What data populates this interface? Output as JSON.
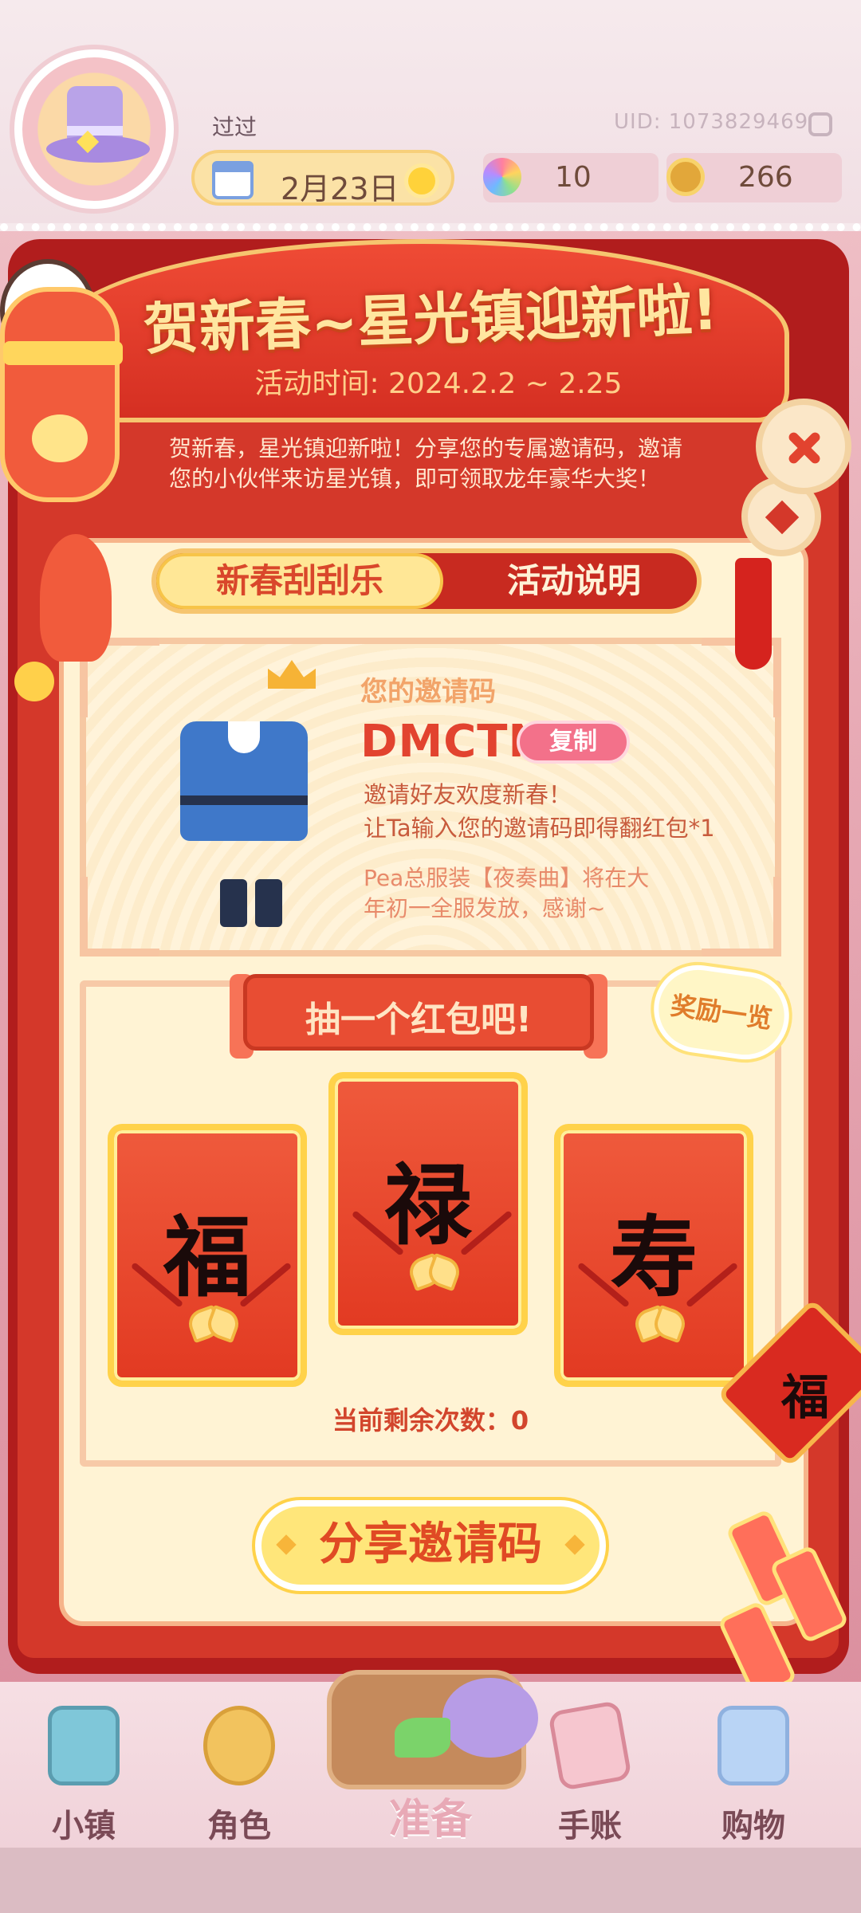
{
  "header": {
    "player_name": "过过",
    "uid": "UID: 1073829469",
    "date": "2月23日",
    "flowers": "10",
    "coins": "266"
  },
  "event": {
    "title": "贺新春~星光镇迎新啦!",
    "time": "活动时间: 2024.2.2 ~ 2.25",
    "description": "贺新春，星光镇迎新啦！分享您的专属邀请码，邀请您的小伙伴来访星光镇，即可领取龙年豪华大奖！"
  },
  "tabs": {
    "active": "新春刮刮乐",
    "other": "活动说明"
  },
  "invite": {
    "label": "您的邀请码",
    "code": "DMCTN",
    "copy_label": "复制",
    "line1": "邀请好友欢度新春！",
    "line2": "让Ta输入您的邀请码即得翻红包*1",
    "note1": "Pea总服装【夜奏曲】将在大",
    "note2": "年初一全服发放，感谢~"
  },
  "draw": {
    "title": "抽一个红包吧!",
    "reward_list": "奖励一览",
    "envelopes": [
      "福",
      "禄",
      "寿"
    ],
    "remaining": "当前剩余次数：0"
  },
  "share_button": "分享邀请码",
  "decor": {
    "knot_char": "福"
  },
  "nav": {
    "items": [
      "小镇",
      "角色",
      "准备",
      "手账",
      "购物"
    ],
    "active_index": 2
  },
  "colors": {
    "primary_red": "#d4382a",
    "gold": "#ffd24a",
    "cream": "#fff3d4",
    "pink_copy": "#f3718a"
  }
}
